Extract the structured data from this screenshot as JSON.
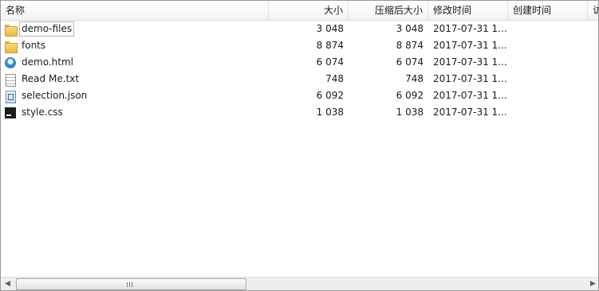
{
  "columns": {
    "name": "名称",
    "size": "大小",
    "packed": "压缩后大小",
    "modified": "修改时间",
    "created": "创建时间",
    "extra": "访"
  },
  "files": [
    {
      "name": "demo-files",
      "size": "3 048",
      "packed": "3 048",
      "modified": "2017-07-31 1...",
      "icon": "folder-icon"
    },
    {
      "name": "fonts",
      "size": "8 874",
      "packed": "8 874",
      "modified": "2017-07-31 1...",
      "icon": "folder-icon"
    },
    {
      "name": "demo.html",
      "size": "6 074",
      "packed": "6 074",
      "modified": "2017-07-31 1...",
      "icon": "html-file-icon"
    },
    {
      "name": "Read Me.txt",
      "size": "748",
      "packed": "748",
      "modified": "2017-07-31 1...",
      "icon": "text-file-icon"
    },
    {
      "name": "selection.json",
      "size": "6 092",
      "packed": "6 092",
      "modified": "2017-07-31 1...",
      "icon": "json-file-icon"
    },
    {
      "name": "style.css",
      "size": "1 038",
      "packed": "1 038",
      "modified": "2017-07-31 1...",
      "icon": "webstorm-file-icon"
    }
  ],
  "scrollbar": {
    "left_arrow": "◀",
    "right_arrow": "▶"
  }
}
